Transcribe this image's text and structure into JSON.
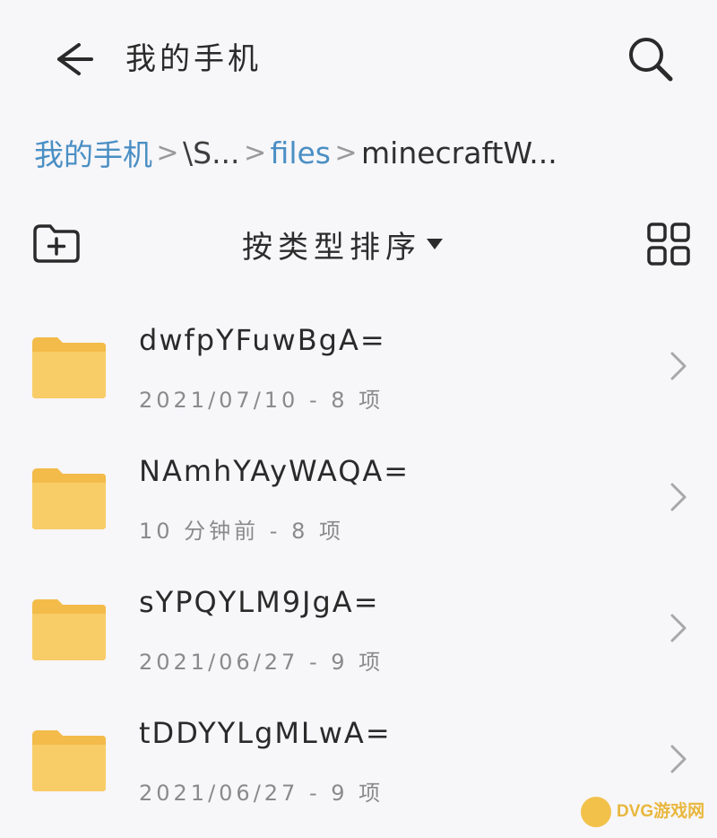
{
  "header": {
    "title": "我的手机",
    "back_icon": "arrow-left-icon",
    "search_icon": "search-icon"
  },
  "breadcrumb": {
    "items": [
      {
        "label": "我的手机",
        "style": "link"
      },
      {
        "label": "\\S...",
        "style": "mid"
      },
      {
        "label": "files",
        "style": "link"
      },
      {
        "label": "minecraftW...",
        "style": "current"
      }
    ],
    "separator": ">"
  },
  "toolbar": {
    "new_folder_icon": "new-folder-icon",
    "sort_label": "按类型排序",
    "grid_icon": "grid-view-icon"
  },
  "folders": [
    {
      "name": "dwfpYFuwBgA=",
      "meta": "2021/07/10 - 8 项"
    },
    {
      "name": "NAmhYAyWAQA=",
      "meta": "10 分钟前 - 8 项"
    },
    {
      "name": "sYPQYLM9JgA=",
      "meta": "2021/06/27 - 9 项"
    },
    {
      "name": "tDDYYLgMLwA=",
      "meta": "2021/06/27 - 9 项"
    }
  ],
  "watermark": {
    "text": "DVG游戏网"
  },
  "colors": {
    "background": "#f7f6f9",
    "breadcrumb_link": "#4a8fc4",
    "folder": "#f6c65b",
    "meta_text": "#8a8a8a"
  }
}
